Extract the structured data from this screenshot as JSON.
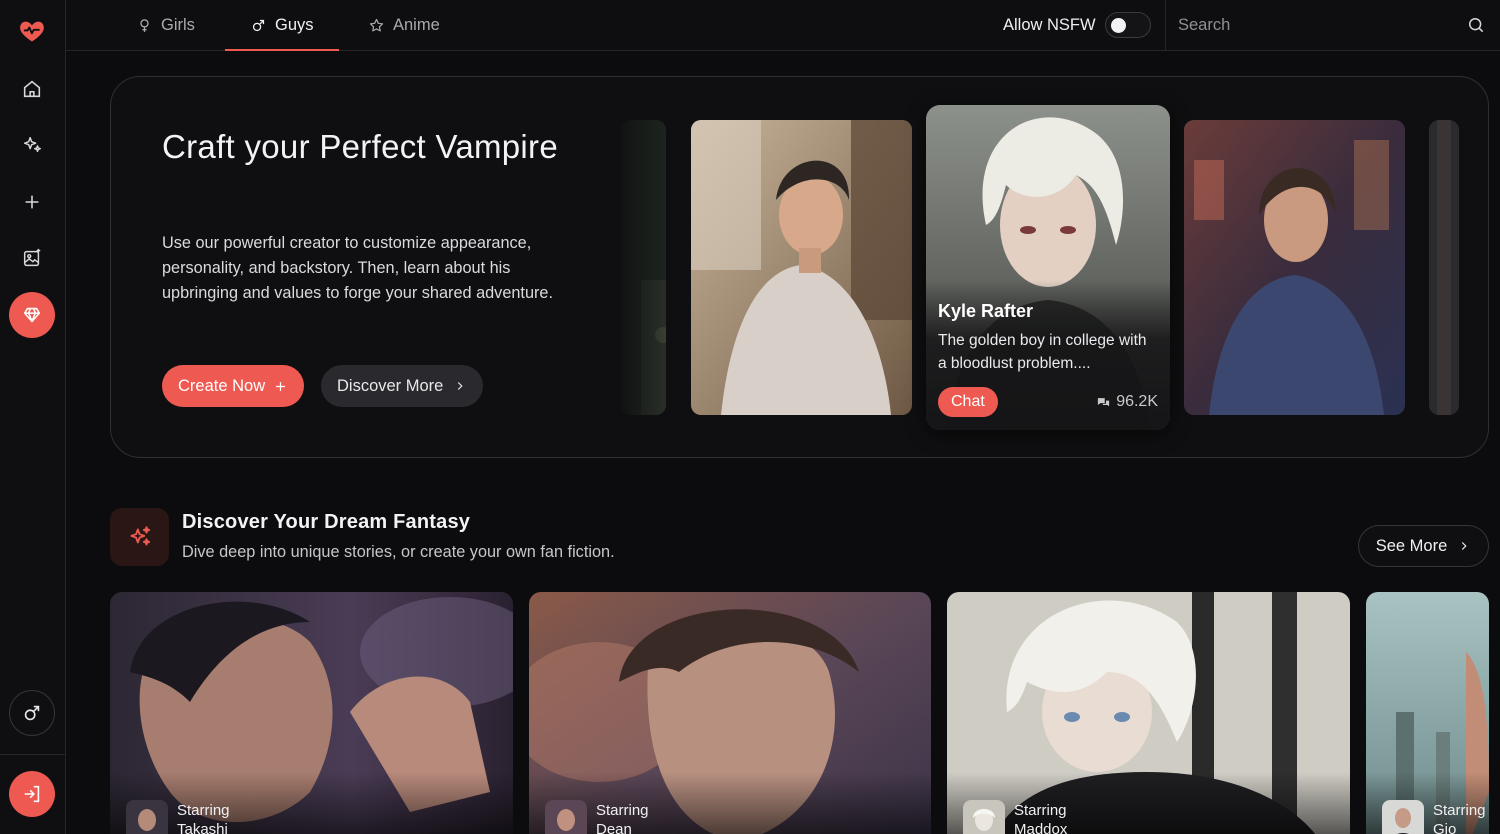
{
  "nav": {
    "tabs": [
      {
        "label": "Girls",
        "icon": "female-icon"
      },
      {
        "label": "Guys",
        "icon": "male-icon",
        "active": true
      },
      {
        "label": "Anime",
        "icon": "star-icon"
      }
    ],
    "nsfw_label": "Allow NSFW",
    "nsfw_enabled": false,
    "search_placeholder": "Search"
  },
  "sidebar": {
    "icons": [
      "heart-pulse-logo-icon",
      "home-icon",
      "sparkles-icon",
      "plus-icon",
      "image-sparkle-icon",
      "diamond-icon",
      "male-gender-icon",
      "login-icon"
    ],
    "active": "diamond-icon"
  },
  "hero": {
    "title": "Craft your Perfect Vampire",
    "description": "Use our powerful creator to customize appearance, personality, and backstory. Then, learn about his upbringing and values to forge your shared adventure.",
    "create_label": "Create Now",
    "discover_label": "Discover More",
    "featured": {
      "name": "Kyle Rafter",
      "description": "The golden boy in college with a bloodlust problem....",
      "chat_label": "Chat",
      "chat_count": "96.2K"
    }
  },
  "section": {
    "title": "Discover Your Dream Fantasy",
    "subtitle": "Dive deep into unique stories, or create your own fan fiction.",
    "see_more_label": "See More",
    "stories": [
      {
        "starring": "Starring",
        "name": "Takashi"
      },
      {
        "starring": "Starring",
        "name": "Dean"
      },
      {
        "starring": "Starring",
        "name": "Maddox"
      },
      {
        "starring": "Starring",
        "name": "Gio Bom"
      }
    ]
  },
  "colors": {
    "accent": "#ee5a52",
    "background": "#0c0c0e",
    "surface": "#0f0f11",
    "border": "#2f2f34"
  }
}
